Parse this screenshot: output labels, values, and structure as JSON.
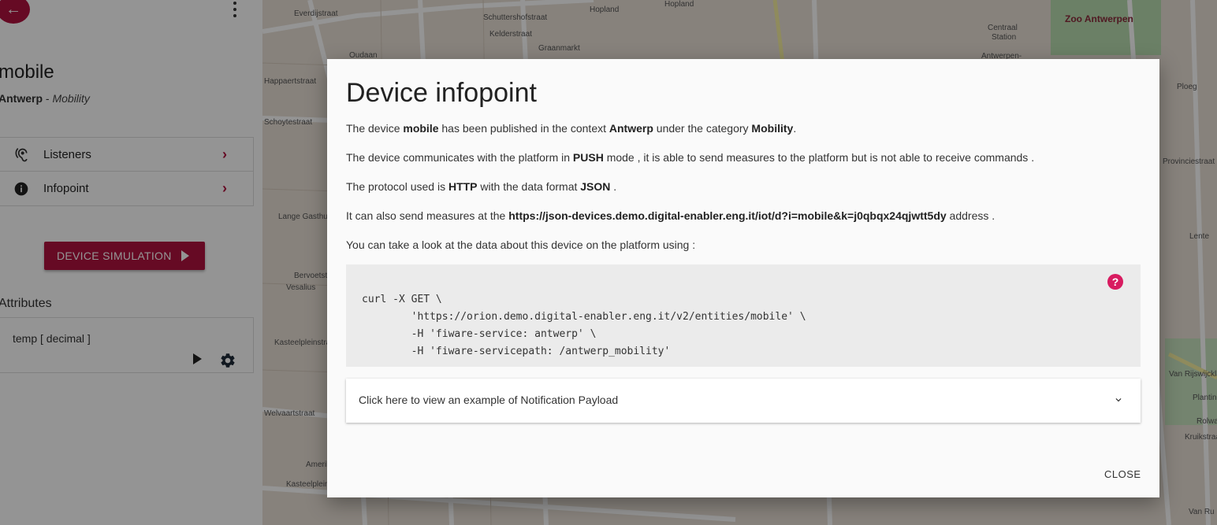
{
  "sidebar": {
    "device_name": "mobile",
    "context": "Antwerp",
    "separator": " - ",
    "category": "Mobility",
    "menu": [
      {
        "label": "Listeners"
      },
      {
        "label": "Infopoint"
      }
    ],
    "sim_button": "DEVICE SIMULATION",
    "attributes_heading": "Attributes",
    "attribute": "temp [ decimal ]"
  },
  "map": {
    "labels": [
      "Everdijstraat",
      "Schuttershofstraat",
      "Hopland",
      "Hopland",
      "Kelderstraat",
      "Graanmarkt",
      "Oudaan",
      "Happaertstraat",
      "Schoytestraat",
      "Lange Gasthuisstraat",
      "Vesalius",
      "Bervoetstraat",
      "Kasteelpleinstraat",
      "Amerikalei",
      "Welvaartstraat",
      "Kasteelplein",
      "Zoo Antwerpen",
      "Antwerpen-",
      "Ploeg",
      "Provinciestraat",
      "Lente",
      "Plantin",
      "Van Rijswijcklaan",
      "Kruikstraat",
      "Rolwagenstraat",
      "Van Ru",
      "Centraal",
      "Station"
    ]
  },
  "dialog": {
    "title": "Device infopoint",
    "p1": {
      "pre": "The device ",
      "device": "mobile",
      "mid": " has been published in the context ",
      "context": "Antwerp",
      "mid2": " under the category ",
      "category": "Mobility",
      "end": "."
    },
    "p2": {
      "pre": "The device communicates with the platform in ",
      "mode": "PUSH",
      "end": " mode , it is able to send measures to the platform but is not able to receive commands ."
    },
    "p3": {
      "pre": "The protocol used is ",
      "protocol": "HTTP",
      "mid": " with the data format ",
      "format": "JSON",
      "end": " ."
    },
    "p4": {
      "pre": "It can also send measures at the ",
      "url": "https://json-devices.demo.digital-enabler.eng.it/iot/d?i=mobile&k=j0qbqx24qjwtt5dy",
      "end": " address ."
    },
    "p5": "You can take a look at the data about this device on the platform using :",
    "code": "curl -X GET \\\n        'https://orion.demo.digital-enabler.eng.it/v2/entities/mobile' \\\n        -H 'fiware-service: antwerp' \\\n        -H 'fiware-servicepath: /antwerp_mobility'",
    "help": "?",
    "expander": "Click here to view an example of Notification Payload",
    "close": "CLOSE"
  },
  "colors": {
    "accent": "#b0123f",
    "help": "#d81b60"
  }
}
